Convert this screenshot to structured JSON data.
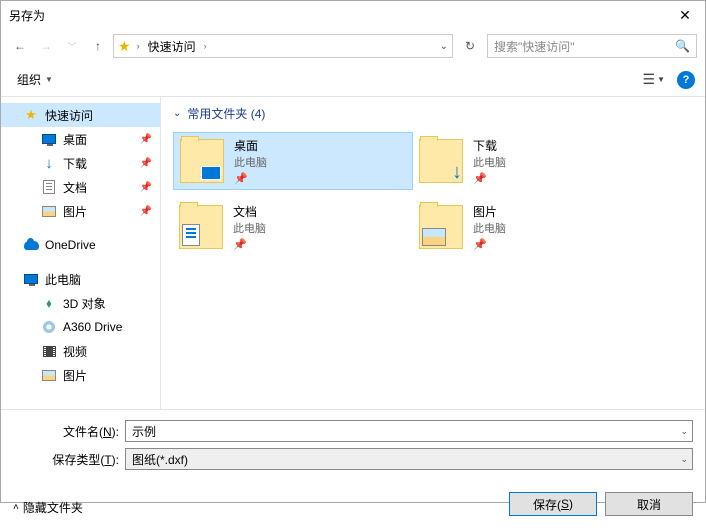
{
  "title": "另存为",
  "nav": {
    "crumb_root": "快速访问",
    "search_placeholder": "搜索\"快速访问\"",
    "refresh_icon": "↻"
  },
  "toolbar": {
    "organize": "组织",
    "help": "?"
  },
  "sidebar": {
    "items": [
      {
        "label": "快速访问",
        "icon": "star",
        "selected": true,
        "pinned": false,
        "indent": 0
      },
      {
        "label": "桌面",
        "icon": "monitor",
        "selected": false,
        "pinned": true,
        "indent": 1
      },
      {
        "label": "下载",
        "icon": "download",
        "selected": false,
        "pinned": true,
        "indent": 1
      },
      {
        "label": "文档",
        "icon": "doc",
        "selected": false,
        "pinned": true,
        "indent": 1
      },
      {
        "label": "图片",
        "icon": "pic",
        "selected": false,
        "pinned": true,
        "indent": 1
      },
      {
        "label": "OneDrive",
        "icon": "onedrive",
        "selected": false,
        "pinned": false,
        "indent": 0,
        "gap": true
      },
      {
        "label": "此电脑",
        "icon": "monitor",
        "selected": false,
        "pinned": false,
        "indent": 0,
        "gap": true
      },
      {
        "label": "3D 对象",
        "icon": "cube",
        "selected": false,
        "pinned": false,
        "indent": 1
      },
      {
        "label": "A360 Drive",
        "icon": "disk",
        "selected": false,
        "pinned": false,
        "indent": 1
      },
      {
        "label": "视频",
        "icon": "film",
        "selected": false,
        "pinned": false,
        "indent": 1
      },
      {
        "label": "图片",
        "icon": "pic",
        "selected": false,
        "pinned": false,
        "indent": 1
      }
    ]
  },
  "main": {
    "section_title": "常用文件夹 (4)",
    "tiles": [
      {
        "name": "桌面",
        "sub": "此电脑",
        "pinned": true,
        "icon": "desktop",
        "selected": true
      },
      {
        "name": "下载",
        "sub": "此电脑",
        "pinned": true,
        "icon": "download",
        "selected": false
      },
      {
        "name": "文档",
        "sub": "此电脑",
        "pinned": true,
        "icon": "docs",
        "selected": false
      },
      {
        "name": "图片",
        "sub": "此电脑",
        "pinned": true,
        "icon": "pics",
        "selected": false
      }
    ]
  },
  "form": {
    "filename_label_pre": "文件名(",
    "filename_label_u": "N",
    "filename_label_post": "):",
    "filename_value": "示例",
    "filetype_label_pre": "保存类型(",
    "filetype_label_u": "T",
    "filetype_label_post": "):",
    "filetype_value": "图纸(*.dxf)"
  },
  "actions": {
    "hide_folders": "隐藏文件夹",
    "save_pre": "保存(",
    "save_u": "S",
    "save_post": ")",
    "cancel": "取消"
  }
}
